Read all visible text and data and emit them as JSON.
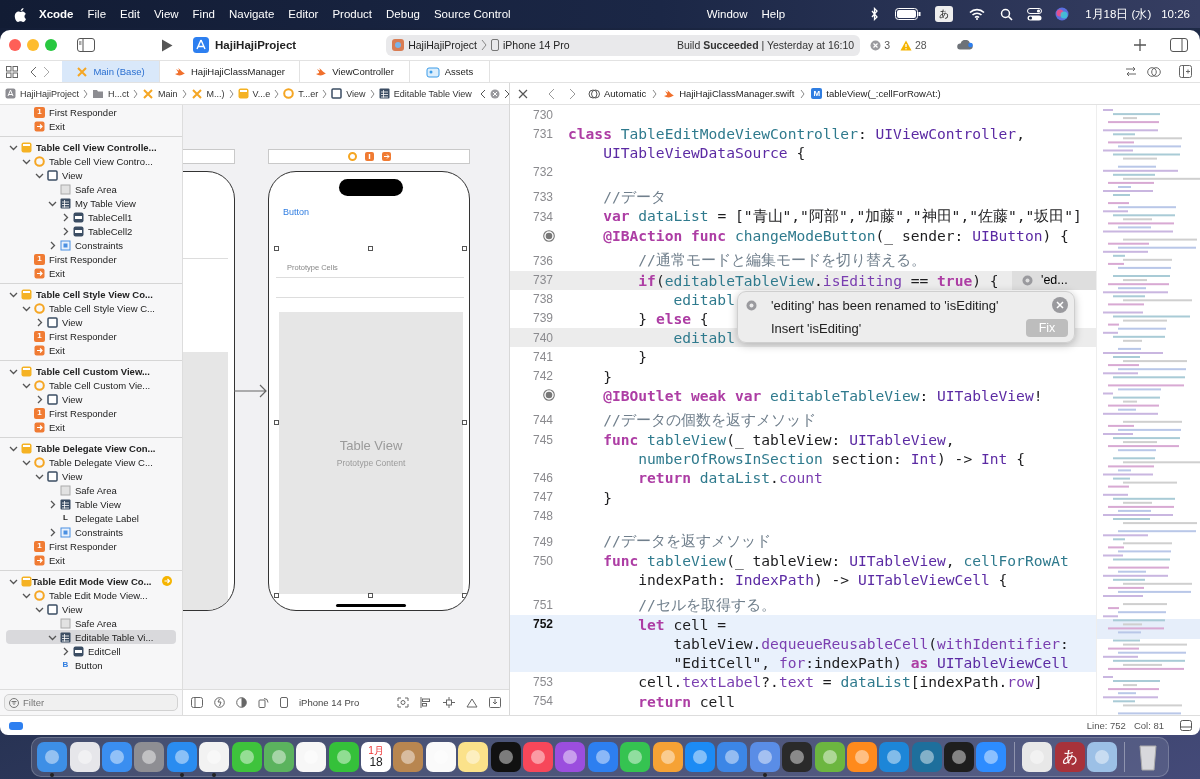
{
  "menubar": {
    "app_name": "Xcode",
    "menus": [
      "File",
      "Edit",
      "View",
      "Find",
      "Navigate",
      "Editor",
      "Product",
      "Debug",
      "Source Control"
    ],
    "menus_after_notch": [
      "Window",
      "Help"
    ],
    "input_source": "あ",
    "date": "1月18日 (水)",
    "time": "10:26"
  },
  "toolbar": {
    "project": "HajiHajiProject",
    "scheme": "HajiHajiProject",
    "device": "iPhone 14 Pro",
    "build_status": "Build **Succeeded** | Yesterday at 16:10",
    "errors": "3",
    "warnings": "28"
  },
  "tabs": [
    {
      "label": "Main (Base)",
      "kind": "storyboard",
      "selected": true
    },
    {
      "label": "HajiHajiClassManager",
      "kind": "swift",
      "selected": false
    },
    {
      "label": "ViewController",
      "kind": "swift",
      "selected": false
    },
    {
      "label": "Assets",
      "kind": "assets",
      "selected": false
    }
  ],
  "jump_bar_left": [
    {
      "label": "HajiHajiProject",
      "kind": "project"
    },
    {
      "label": "H...ct",
      "kind": "folder"
    },
    {
      "label": "Main",
      "kind": "storyboard"
    },
    {
      "label": "M...)",
      "kind": "storyboard"
    },
    {
      "label": "V...e",
      "kind": "scene"
    },
    {
      "label": "T...er",
      "kind": "controller"
    },
    {
      "label": "View",
      "kind": "view"
    },
    {
      "label": "Editable Table View",
      "kind": "table"
    }
  ],
  "jump_bar_right": [
    {
      "label": "Automatic",
      "kind": "related"
    },
    {
      "label": "HajiHajiClassManager.swift",
      "kind": "swift"
    },
    {
      "label": "tableView(_:cellForRowAt:)",
      "kind": "method",
      "icon_text": "M"
    }
  ],
  "navigator": {
    "filter_placeholder": "Filter",
    "outline": [
      {
        "children": [
          {
            "label": "First Responder",
            "kind": "responder",
            "icon_text": "1",
            "selected": false
          },
          {
            "label": "Exit",
            "kind": "exit",
            "selected": false
          }
        ]
      },
      {
        "label": "Table Cell View Controlle...",
        "kind": "scene",
        "expanded": true,
        "entry_point": false,
        "selected": false,
        "children": [
          {
            "label": "Table Cell View Contro...",
            "kind": "controller",
            "expanded": true,
            "selected": false,
            "children": [
              {
                "label": "View",
                "kind": "view",
                "expanded": true,
                "selected": false,
                "children": [
                  {
                    "label": "Safe Area",
                    "kind": "safearea",
                    "selected": false
                  },
                  {
                    "label": "My Table View",
                    "kind": "table",
                    "expanded": true,
                    "selected": false,
                    "children": [
                      {
                        "label": "TableCell1",
                        "kind": "cell",
                        "expanded": false,
                        "selected": false
                      },
                      {
                        "label": "TableCell2",
                        "kind": "cell",
                        "expanded": false,
                        "selected": false
                      }
                    ]
                  },
                  {
                    "label": "Constraints",
                    "kind": "constraints",
                    "expanded": false,
                    "selected": false
                  }
                ]
              }
            ]
          },
          {
            "label": "First Responder",
            "kind": "responder",
            "icon_text": "1",
            "selected": false
          },
          {
            "label": "Exit",
            "kind": "exit",
            "selected": false
          }
        ]
      },
      {
        "label": "Table Cell Style View Co...",
        "kind": "scene",
        "expanded": true,
        "entry_point": false,
        "selected": false,
        "children": [
          {
            "label": "Table Cell Style View C...",
            "kind": "controller",
            "expanded": true,
            "selected": false,
            "children": [
              {
                "label": "View",
                "kind": "view",
                "expanded": false,
                "selected": false
              }
            ]
          },
          {
            "label": "First Responder",
            "kind": "responder",
            "icon_text": "1",
            "selected": false
          },
          {
            "label": "Exit",
            "kind": "exit",
            "selected": false
          }
        ]
      },
      {
        "label": "Table Cell Custom View...",
        "kind": "scene",
        "expanded": true,
        "entry_point": false,
        "selected": false,
        "children": [
          {
            "label": "Table Cell Custom Vie...",
            "kind": "controller",
            "expanded": true,
            "selected": false,
            "children": [
              {
                "label": "View",
                "kind": "view",
                "expanded": false,
                "selected": false
              }
            ]
          },
          {
            "label": "First Responder",
            "kind": "responder",
            "icon_text": "1",
            "selected": false
          },
          {
            "label": "Exit",
            "kind": "exit",
            "selected": false
          }
        ]
      },
      {
        "label": "Table Delegate View Con...",
        "kind": "scene",
        "expanded": true,
        "entry_point": false,
        "selected": false,
        "children": [
          {
            "label": "Table Delegate View C...",
            "kind": "controller",
            "expanded": true,
            "selected": false,
            "children": [
              {
                "label": "View",
                "kind": "view",
                "expanded": true,
                "selected": false,
                "children": [
                  {
                    "label": "Safe Area",
                    "kind": "safearea",
                    "selected": false
                  },
                  {
                    "label": "Table View",
                    "kind": "table",
                    "expanded": false,
                    "selected": false
                  },
                  {
                    "label": "Delegate Label",
                    "kind": "label",
                    "icon_text": "L",
                    "selected": false
                  },
                  {
                    "label": "Constraints",
                    "kind": "constraints",
                    "expanded": false,
                    "selected": false
                  }
                ]
              }
            ]
          },
          {
            "label": "First Responder",
            "kind": "responder",
            "icon_text": "1",
            "selected": false
          },
          {
            "label": "Exit",
            "kind": "exit",
            "selected": false
          }
        ]
      },
      {
        "label": "Table Edit Mode View Co...",
        "kind": "scene",
        "expanded": true,
        "entry_point": true,
        "selected": false,
        "children": [
          {
            "label": "Table Edit Mode View...",
            "kind": "controller",
            "expanded": true,
            "selected": false,
            "children": [
              {
                "label": "View",
                "kind": "view",
                "expanded": true,
                "selected": false,
                "children": [
                  {
                    "label": "Safe Area",
                    "kind": "safearea",
                    "selected": false
                  },
                  {
                    "label": "Editable Table Vi...",
                    "kind": "table",
                    "expanded": true,
                    "selected": true,
                    "children": [
                      {
                        "label": "EditCell",
                        "kind": "cell",
                        "expanded": false,
                        "selected": false
                      }
                    ]
                  },
                  {
                    "label": "Button",
                    "kind": "button",
                    "icon_text": "B",
                    "selected": false
                  }
                ]
              }
            ]
          }
        ]
      }
    ]
  },
  "canvas": {
    "button_label": "Button",
    "table_view": {
      "section_label": "Prototype Cells",
      "title": "Table View",
      "subtitle": "Prototype Content",
      "selected": true
    },
    "device": "iPhone 14 Pro"
  },
  "editor": {
    "lines": [
      {
        "number": "730",
        "connection": false,
        "current": false,
        "issue_highlight": false
      },
      {
        "number": "731",
        "connection": false,
        "current": false,
        "issue_highlight": false,
        "segments": [
          {
            "kind": "keyword",
            "text": "class "
          },
          {
            "kind": "project",
            "text": "TableEditModeViewController"
          },
          {
            "kind": "plain",
            "text": ": "
          },
          {
            "kind": "type",
            "text": "UIViewController"
          },
          {
            "kind": "plain",
            "text": ","
          }
        ]
      },
      {
        "connection": false,
        "current": false,
        "issue_highlight": false,
        "segments": [
          {
            "kind": "type",
            "text": "    UITableViewDataSource"
          },
          {
            "kind": "plain",
            "text": " {"
          }
        ]
      },
      {
        "number": "732",
        "connection": false,
        "current": false,
        "issue_highlight": false
      },
      {
        "number": "733",
        "connection": false,
        "current": false,
        "issue_highlight": false,
        "segments": [
          {
            "kind": "comment",
            "text": "    //データ"
          }
        ]
      },
      {
        "number": "734",
        "connection": false,
        "current": false,
        "issue_highlight": false,
        "segments": [
          {
            "kind": "keyword",
            "text": "    var "
          },
          {
            "kind": "project",
            "text": "dataList"
          },
          {
            "kind": "plain",
            "text": " = [\"青山\",\"阿部\",\"加藤\",\"神田\",\"佐藤\",\"坂田\"]"
          }
        ]
      },
      {
        "connection": true,
        "current": false,
        "issue_highlight": false,
        "segments": [
          {
            "kind": "keyword",
            "text": "    @IBAction func "
          },
          {
            "kind": "project",
            "text": "changeModeButton"
          },
          {
            "kind": "plain",
            "text": "(_ sender: "
          },
          {
            "kind": "type",
            "text": "UIButton"
          },
          {
            "kind": "plain",
            "text": ") {"
          }
        ]
      },
      {
        "number": "736",
        "connection": false,
        "current": false,
        "issue_highlight": false,
        "segments": [
          {
            "kind": "comment",
            "text": "        //通常モードと編集モードを切り替える。"
          }
        ]
      },
      {
        "number": "737",
        "connection": false,
        "current": false,
        "issue_highlight": true,
        "issue": "'ed...",
        "segments": [
          {
            "kind": "keyword",
            "text": "        if"
          },
          {
            "kind": "plain",
            "text": "("
          },
          {
            "kind": "project",
            "text": "editableTableView"
          },
          {
            "kind": "plain",
            "text": "."
          },
          {
            "kind": "member",
            "text": "isEditing"
          },
          {
            "kind": "plain",
            "text": " == "
          },
          {
            "kind": "keyword",
            "text": "true"
          },
          {
            "kind": "plain",
            "text": ") {"
          }
        ]
      },
      {
        "number": "738",
        "connection": false,
        "current": false,
        "issue_highlight": false,
        "segments": [
          {
            "kind": "project",
            "text": "            editabl"
          }
        ]
      },
      {
        "number": "739",
        "connection": false,
        "current": false,
        "issue_highlight": false,
        "segments": [
          {
            "kind": "plain",
            "text": "        } "
          },
          {
            "kind": "keyword",
            "text": "else"
          },
          {
            "kind": "plain",
            "text": " {"
          }
        ]
      },
      {
        "number": "740",
        "connection": false,
        "current": false,
        "issue_highlight": true,
        "segments": [
          {
            "kind": "project",
            "text": "            editabl"
          }
        ]
      },
      {
        "number": "741",
        "connection": false,
        "current": false,
        "issue_highlight": false,
        "segments": [
          {
            "kind": "plain",
            "text": "        }"
          }
        ]
      },
      {
        "number": "742",
        "connection": false,
        "current": false,
        "issue_highlight": false,
        "segments": [
          {
            "kind": "plain",
            "text": "    }"
          }
        ]
      },
      {
        "connection": true,
        "current": false,
        "issue_highlight": false,
        "segments": [
          {
            "kind": "keyword",
            "text": "    @IBOutlet weak var "
          },
          {
            "kind": "project",
            "text": "editableTableView"
          },
          {
            "kind": "plain",
            "text": ": "
          },
          {
            "kind": "type",
            "text": "UITableView"
          },
          {
            "kind": "plain",
            "text": "!"
          }
        ]
      },
      {
        "number": "744",
        "connection": false,
        "current": false,
        "issue_highlight": false,
        "segments": [
          {
            "kind": "comment",
            "text": "    //データの個数を返すメソッド"
          }
        ]
      },
      {
        "number": "745",
        "connection": false,
        "current": false,
        "issue_highlight": false,
        "segments": [
          {
            "kind": "keyword",
            "text": "    func "
          },
          {
            "kind": "project",
            "text": "tableView"
          },
          {
            "kind": "plain",
            "text": "(_ tableView: "
          },
          {
            "kind": "type",
            "text": "UITableView"
          },
          {
            "kind": "plain",
            "text": ","
          }
        ]
      },
      {
        "connection": false,
        "current": false,
        "issue_highlight": false,
        "segments": [
          {
            "kind": "project",
            "text": "        numberOfRowsInSection"
          },
          {
            "kind": "plain",
            "text": " section: "
          },
          {
            "kind": "type",
            "text": "Int"
          },
          {
            "kind": "plain",
            "text": ") -> "
          },
          {
            "kind": "type",
            "text": "Int"
          },
          {
            "kind": "plain",
            "text": " {"
          }
        ]
      },
      {
        "number": "746",
        "connection": false,
        "current": false,
        "issue_highlight": false,
        "segments": [
          {
            "kind": "keyword",
            "text": "        return "
          },
          {
            "kind": "project",
            "text": "dataList"
          },
          {
            "kind": "plain",
            "text": "."
          },
          {
            "kind": "member",
            "text": "count"
          }
        ]
      },
      {
        "number": "747",
        "connection": false,
        "current": false,
        "issue_highlight": false,
        "segments": [
          {
            "kind": "plain",
            "text": "    }"
          }
        ]
      },
      {
        "number": "748",
        "connection": false,
        "current": false,
        "issue_highlight": false
      },
      {
        "number": "749",
        "connection": false,
        "current": false,
        "issue_highlight": false,
        "segments": [
          {
            "kind": "comment",
            "text": "    //データを返すメソッド"
          }
        ]
      },
      {
        "number": "750",
        "connection": false,
        "current": false,
        "issue_highlight": false,
        "segments": [
          {
            "kind": "keyword",
            "text": "    func "
          },
          {
            "kind": "project",
            "text": "tableView"
          },
          {
            "kind": "plain",
            "text": "(_ tableView: "
          },
          {
            "kind": "type",
            "text": "UITableView"
          },
          {
            "kind": "plain",
            "text": ", "
          },
          {
            "kind": "project",
            "text": "cellForRowAt"
          }
        ]
      },
      {
        "connection": false,
        "current": false,
        "issue_highlight": false,
        "segments": [
          {
            "kind": "plain",
            "text": "        indexPath: "
          },
          {
            "kind": "type",
            "text": "IndexPath"
          },
          {
            "kind": "plain",
            "text": ") -> "
          },
          {
            "kind": "type",
            "text": "UITableViewCell"
          },
          {
            "kind": "plain",
            "text": " {"
          }
        ]
      },
      {
        "number": "751",
        "connection": false,
        "current": false,
        "issue_highlight": false,
        "segments": [
          {
            "kind": "comment",
            "text": "        //セルを取得する。"
          }
        ]
      },
      {
        "number": "752",
        "connection": false,
        "current": true,
        "issue_highlight": false,
        "segments": [
          {
            "kind": "keyword",
            "text": "        let"
          },
          {
            "kind": "plain",
            "text": " cell ="
          }
        ]
      },
      {
        "connection": false,
        "current": true,
        "issue_highlight": false,
        "segments": [
          {
            "kind": "plain",
            "text": "            tableView."
          },
          {
            "kind": "member",
            "text": "dequeueReusableCell"
          },
          {
            "kind": "plain",
            "text": "("
          },
          {
            "kind": "member",
            "text": "withIdentifier"
          },
          {
            "kind": "plain",
            "text": ":"
          }
        ]
      },
      {
        "connection": false,
        "current": true,
        "issue_highlight": false,
        "segments": [
          {
            "kind": "plain",
            "text": "            \"EditCell\", "
          },
          {
            "kind": "member",
            "text": "for"
          },
          {
            "kind": "plain",
            "text": ":indexPath) "
          },
          {
            "kind": "keyword",
            "text": "as "
          },
          {
            "kind": "type",
            "text": "UITableViewCell"
          }
        ]
      },
      {
        "number": "753",
        "connection": false,
        "current": false,
        "issue_highlight": false,
        "segments": [
          {
            "kind": "plain",
            "text": "        cell."
          },
          {
            "kind": "member",
            "text": "textLabel"
          },
          {
            "kind": "plain",
            "text": "?."
          },
          {
            "kind": "member",
            "text": "text"
          },
          {
            "kind": "plain",
            "text": " = "
          },
          {
            "kind": "project",
            "text": "dataList"
          },
          {
            "kind": "plain",
            "text": "[indexPath."
          },
          {
            "kind": "member",
            "text": "row"
          },
          {
            "kind": "plain",
            "text": "]"
          }
        ]
      },
      {
        "number": "754",
        "connection": false,
        "current": false,
        "issue_highlight": false,
        "segments": [
          {
            "kind": "keyword",
            "text": "        return"
          },
          {
            "kind": "plain",
            "text": " cell"
          }
        ]
      }
    ],
    "fixit": {
      "message": "'editing' has been renamed to 'isEditing'",
      "action": "Insert 'isEditing'",
      "button": "Fix"
    }
  },
  "status_bar": {
    "line": "Line: 752",
    "column": "Col: 81"
  },
  "dock": [
    {
      "kind": "app",
      "color": "#3d8fe6",
      "running": true
    },
    {
      "kind": "app",
      "color": "#e6e6ea",
      "running": false
    },
    {
      "kind": "app",
      "color": "#3a8ef0",
      "running": false
    },
    {
      "kind": "app",
      "color": "#8e8e93",
      "running": false
    },
    {
      "kind": "app",
      "color": "#2a8cf0",
      "running": true
    },
    {
      "kind": "app",
      "color": "#f2f2f2",
      "running": true
    },
    {
      "kind": "app",
      "color": "#3ec33c",
      "running": false
    },
    {
      "kind": "app",
      "color": "#5bb35e",
      "running": false
    },
    {
      "kind": "app",
      "color": "#f7f7f7",
      "running": false
    },
    {
      "kind": "app",
      "color": "#35c13a",
      "running": false
    },
    {
      "kind": "calendar",
      "color": "#ffffff",
      "month": "1月",
      "text": "18",
      "running": false
    },
    {
      "kind": "app",
      "color": "#b88650",
      "running": false
    },
    {
      "kind": "app",
      "color": "#fafafa",
      "running": false
    },
    {
      "kind": "app",
      "color": "#fbe28a",
      "running": false
    },
    {
      "kind": "app",
      "color": "#111111",
      "running": false
    },
    {
      "kind": "app",
      "color": "#f7475a",
      "running": false
    },
    {
      "kind": "app",
      "color": "#9b4ede",
      "running": false
    },
    {
      "kind": "app",
      "color": "#2d7ff0",
      "running": false
    },
    {
      "kind": "app",
      "color": "#35c351",
      "running": false
    },
    {
      "kind": "app",
      "color": "#f6a235",
      "running": false
    },
    {
      "kind": "app",
      "color": "#1c8bf4",
      "running": false
    },
    {
      "kind": "app",
      "color": "#3c86e6",
      "running": false
    },
    {
      "kind": "app",
      "color": "#5a8de6",
      "running": true
    },
    {
      "kind": "app",
      "color": "#2a2a2a",
      "running": false
    },
    {
      "kind": "app",
      "color": "#6cb640",
      "running": false
    },
    {
      "kind": "app",
      "color": "#ff8a1c",
      "running": false
    },
    {
      "kind": "app",
      "color": "#1d86d8",
      "running": false
    },
    {
      "kind": "app",
      "color": "#1e6f9c",
      "running": false
    },
    {
      "kind": "app",
      "color": "#1e1e1e",
      "running": false
    },
    {
      "kind": "app",
      "color": "#2d8cff",
      "running": false
    },
    {
      "kind": "separator"
    },
    {
      "kind": "app",
      "color": "#e8e8e8",
      "running": false
    },
    {
      "kind": "glyph",
      "color": "#a8323a",
      "text": "あ",
      "running": false
    },
    {
      "kind": "app",
      "color": "#9cc0e6",
      "running": false
    },
    {
      "kind": "separator"
    },
    {
      "kind": "trash",
      "color": "#d8d8dc",
      "running": false
    }
  ]
}
